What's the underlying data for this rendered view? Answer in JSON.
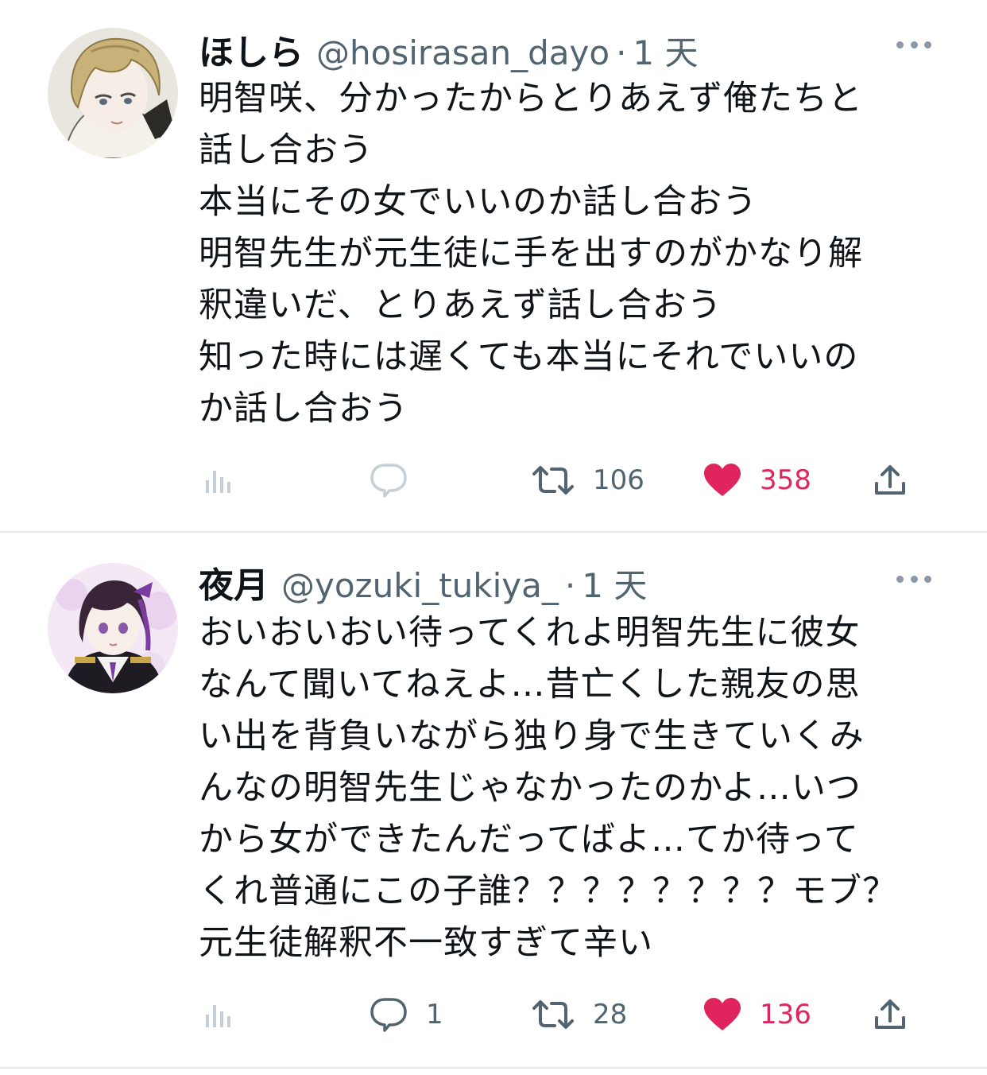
{
  "tweets": [
    {
      "name": "ほしら",
      "handle": "@hosirasan_dayo",
      "separator": "·",
      "time": "1 天",
      "text": "明智咲、分かったからとりあえず俺たちと\n話し合おう\n本当にその女でいいのか話し合おう\n明智先生が元生徒に手を出すのがかなり解\n釈違いだ、とりあえず話し合おう\n知った時には遅くても本当にそれでいいの\nか話し合おう",
      "replies": "",
      "retweets": "106",
      "likes": "358",
      "avatar_icon": "avatar-blond-character"
    },
    {
      "name": "夜月",
      "handle": "@yozuki_tukiya_",
      "separator": "·",
      "time": "1 天",
      "text": "おいおいおい待ってくれよ明智先生に彼女\nなんて聞いてねえよ…昔亡くした親友の思\nい出を背負いながら独り身で生きていくみ\nんなの明智先生じゃなかったのかよ…いつ\nから女ができたんだってばよ…てか待って\nくれ普通にこの子誰？？？？？？？？モブ？\n元生徒解釈不一致すぎて辛い",
      "replies": "1",
      "retweets": "28",
      "likes": "136",
      "avatar_icon": "avatar-purple-hair-character"
    }
  ],
  "colors": {
    "like": "#e0245e",
    "muted": "#536471",
    "icon_faint": "#c4cfd6",
    "divider": "#e6e8ea"
  }
}
